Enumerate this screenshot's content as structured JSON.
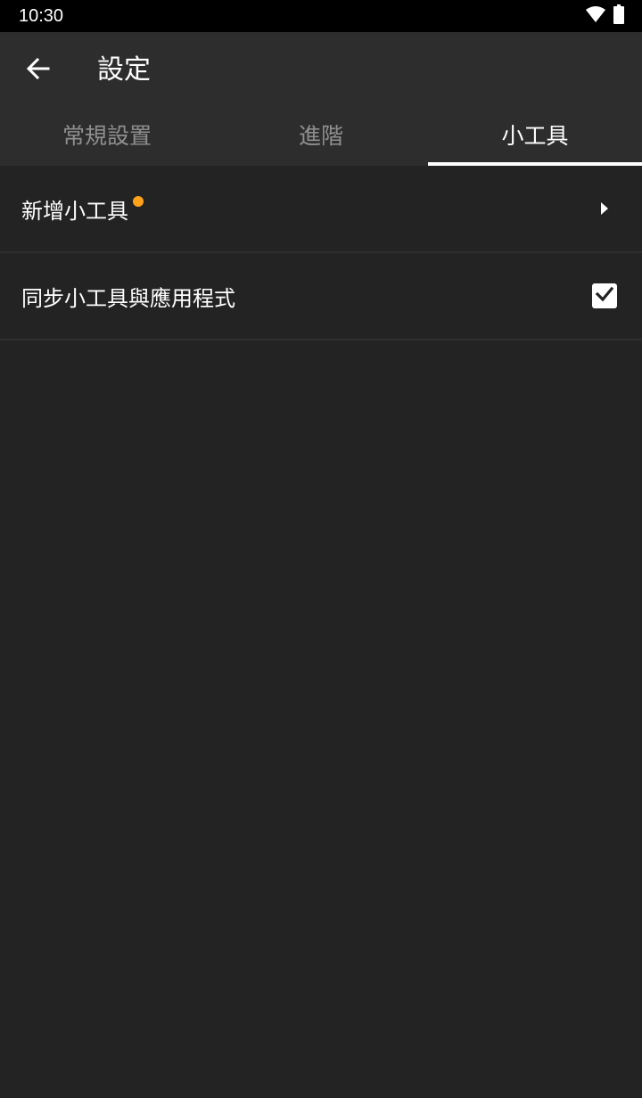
{
  "status_bar": {
    "time": "10:30",
    "icons": [
      "wifi-icon",
      "battery-icon"
    ]
  },
  "header": {
    "title": "設定",
    "back_icon": "arrow-left-icon"
  },
  "tabs": [
    {
      "label": "常規設置",
      "selected": false
    },
    {
      "label": "進階",
      "selected": false
    },
    {
      "label": "小工具",
      "selected": true
    }
  ],
  "settings": [
    {
      "label": "新增小工具",
      "badge": "new-dot",
      "control": "chevron-right-icon"
    },
    {
      "label": "同步小工具與應用程式",
      "control": "checkbox",
      "checked": true
    }
  ],
  "colors": {
    "status_bar": "#000000",
    "toolbar": "#2d2d2d",
    "background": "#232323",
    "badge": "#ffa21a",
    "text": "#ffffff",
    "tab_inactive": "#8f8f8f"
  }
}
